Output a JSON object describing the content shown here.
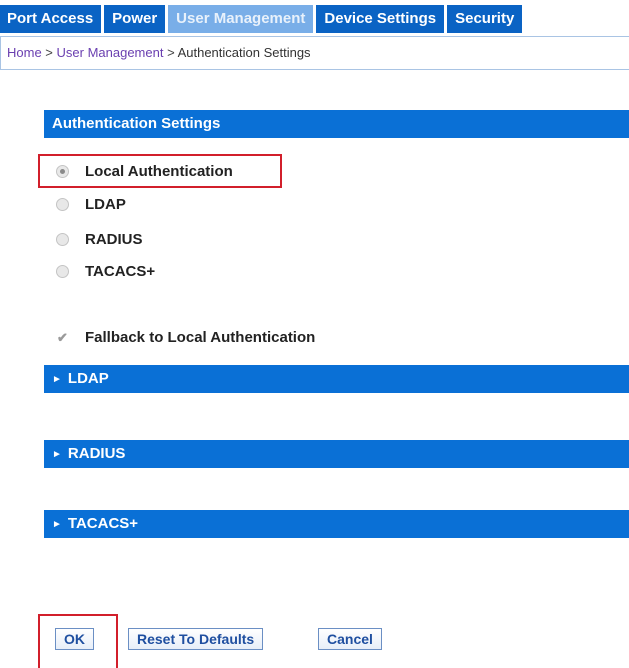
{
  "tabs": [
    {
      "label": "Port Access",
      "active": false
    },
    {
      "label": "Power",
      "active": false
    },
    {
      "label": "User Management",
      "active": true
    },
    {
      "label": "Device Settings",
      "active": false
    },
    {
      "label": "Security",
      "active": false
    }
  ],
  "breadcrumb": {
    "home": "Home",
    "separator": " > ",
    "section": "User Management",
    "current": "Authentication Settings"
  },
  "auth_settings": {
    "title": "Authentication Settings",
    "options": [
      {
        "label": "Local Authentication",
        "selected": true
      },
      {
        "label": "LDAP",
        "selected": false
      },
      {
        "label": "RADIUS",
        "selected": false
      },
      {
        "label": "TACACS+",
        "selected": false
      }
    ],
    "fallback": {
      "label": "Fallback to Local Authentication",
      "checked": true
    }
  },
  "collapsible_sections": [
    {
      "label": "LDAP",
      "arrow": "►"
    },
    {
      "label": "RADIUS",
      "arrow": "►"
    },
    {
      "label": "TACACS+",
      "arrow": "►"
    }
  ],
  "buttons": {
    "ok": "OK",
    "reset": "Reset To Defaults",
    "cancel": "Cancel"
  },
  "colors": {
    "tab_bg": "#0a63c4",
    "tab_active_bg": "#79aee8",
    "section_bg": "#0a70d6",
    "highlight_red": "#d21f2b"
  }
}
